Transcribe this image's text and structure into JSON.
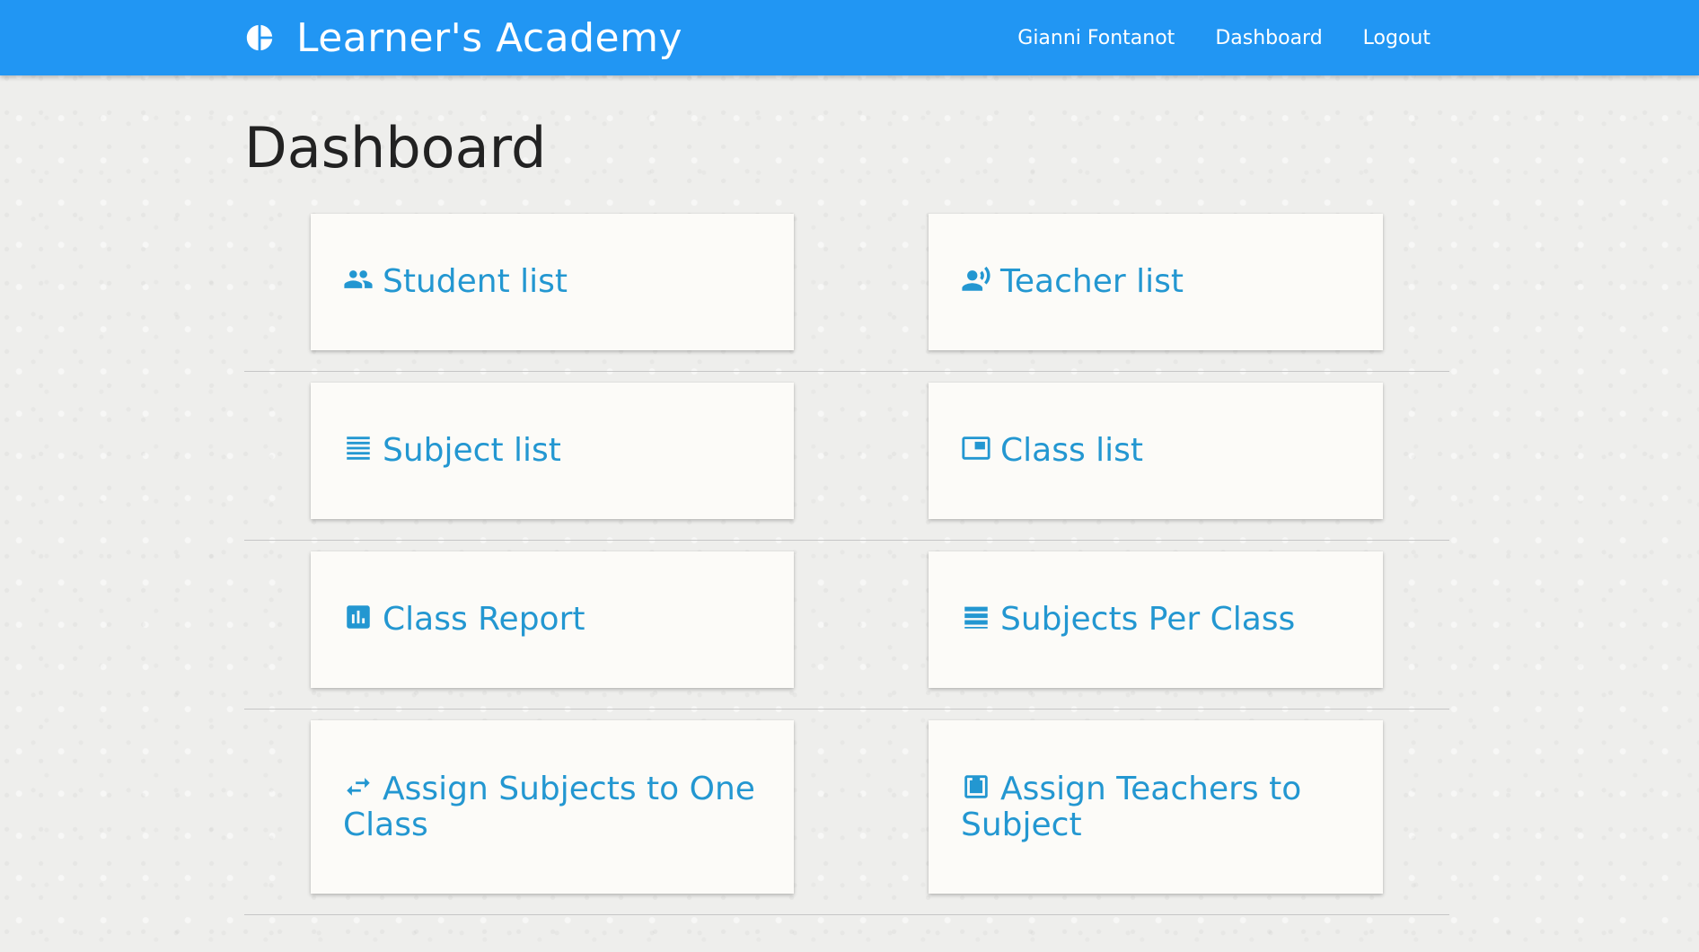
{
  "navbar": {
    "brand": "Learner's Academy",
    "brand_icon": "pie-chart-icon",
    "links": [
      "Gianni Fontanot",
      "Dashboard",
      "Logout"
    ],
    "background": "#2196f3"
  },
  "page": {
    "title": "Dashboard"
  },
  "cards": [
    {
      "label": "Student list",
      "icon": "people-icon"
    },
    {
      "label": "Teacher list",
      "icon": "record-voice-icon"
    },
    {
      "label": "Subject list",
      "icon": "list-lines-icon"
    },
    {
      "label": "Class list",
      "icon": "picture-in-picture-icon"
    },
    {
      "label": "Class Report",
      "icon": "bar-chart-icon"
    },
    {
      "label": "Subjects Per Class",
      "icon": "view-list-icon"
    },
    {
      "label": "Assign Subjects to One Class",
      "icon": "swap-arrows-icon"
    },
    {
      "label": "Assign Teachers to Subject",
      "icon": "download-box-icon"
    }
  ],
  "colors": {
    "link": "#2397d1",
    "card_background": "#fcfbf8"
  }
}
